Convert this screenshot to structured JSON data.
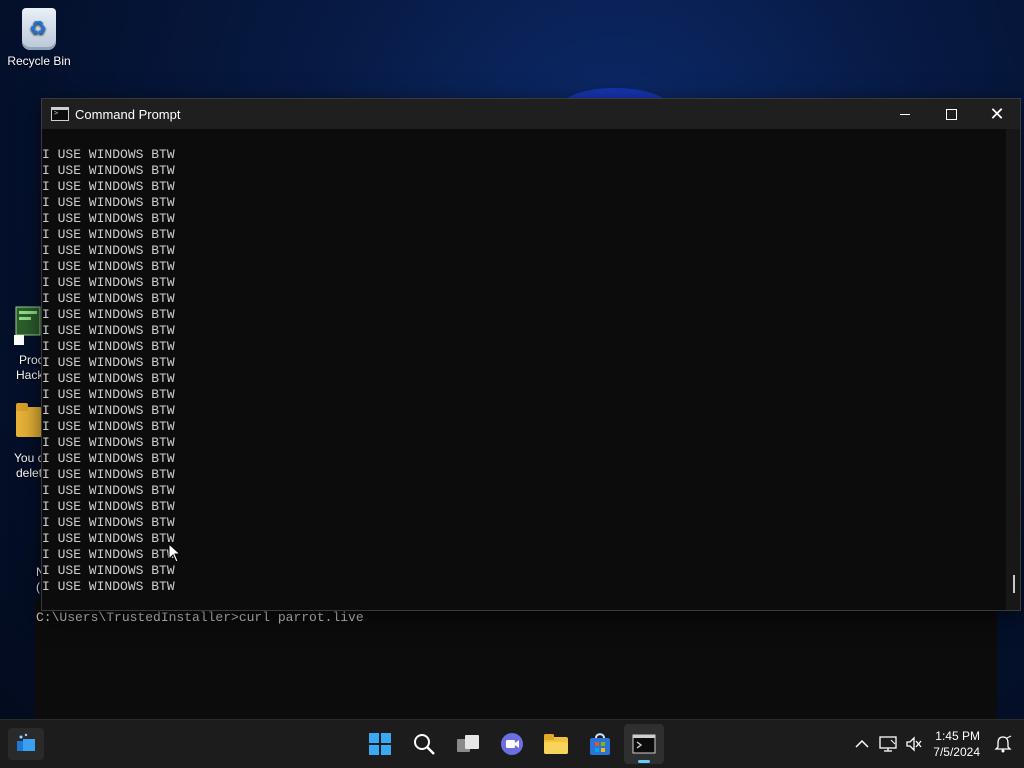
{
  "desktop": {
    "recycle_bin_label": "Recycle Bin",
    "partial_labels": [
      "Proc",
      "Hack",
      "You c",
      "delet",
      "N",
      "("
    ]
  },
  "background_console": {
    "prompt_line": "C:\\Users\\TrustedInstaller>curl parrot.live"
  },
  "window": {
    "title": "Command Prompt",
    "controls": {
      "minimize": "—",
      "maximize": "□",
      "close": "✕"
    },
    "lines": [
      "I USE WINDOWS BTW",
      "I USE WINDOWS BTW",
      "I USE WINDOWS BTW",
      "I USE WINDOWS BTW",
      "I USE WINDOWS BTW",
      "I USE WINDOWS BTW",
      "I USE WINDOWS BTW",
      "I USE WINDOWS BTW",
      "I USE WINDOWS BTW",
      "I USE WINDOWS BTW",
      "I USE WINDOWS BTW",
      "I USE WINDOWS BTW",
      "I USE WINDOWS BTW",
      "I USE WINDOWS BTW",
      "I USE WINDOWS BTW",
      "I USE WINDOWS BTW",
      "I USE WINDOWS BTW",
      "I USE WINDOWS BTW",
      "I USE WINDOWS BTW",
      "I USE WINDOWS BTW",
      "I USE WINDOWS BTW",
      "I USE WINDOWS BTW",
      "I USE WINDOWS BTW",
      "I USE WINDOWS BTW",
      "I USE WINDOWS BTW",
      "I USE WINDOWS BTW",
      "I USE WINDOWS BTW",
      "I USE WINDOWS BTW"
    ]
  },
  "taskbar": {
    "apps": [
      {
        "name": "start-button",
        "icon": "windows-logo-icon"
      },
      {
        "name": "search-button",
        "icon": "search-icon"
      },
      {
        "name": "task-view-button",
        "icon": "task-view-icon"
      },
      {
        "name": "teams-chat-button",
        "icon": "video-chat-icon"
      },
      {
        "name": "file-explorer-button",
        "icon": "folder-icon"
      },
      {
        "name": "microsoft-store-button",
        "icon": "store-icon"
      },
      {
        "name": "command-prompt-taskbar-button",
        "icon": "terminal-icon",
        "active": true
      }
    ],
    "clock": {
      "time": "1:45 PM",
      "date": "7/5/2024"
    }
  },
  "colors": {
    "console_bg": "#0c0c0c",
    "console_text": "#cfcfcf",
    "titlebar_bg": "#1f1f1f",
    "taskbar_bg": "#1c1c1c",
    "accent": "#60cdff"
  }
}
